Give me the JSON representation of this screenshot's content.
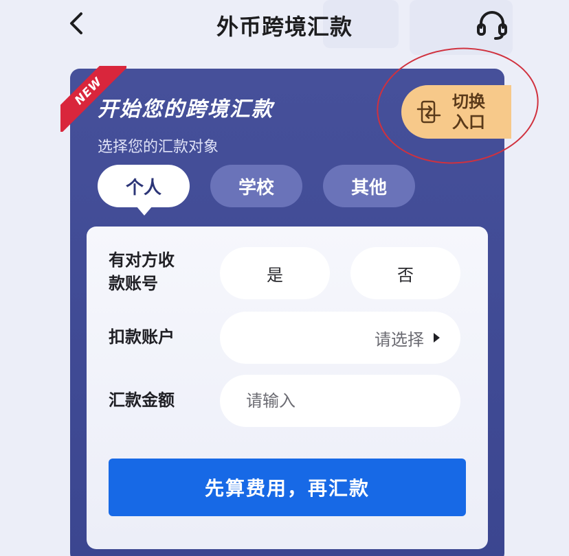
{
  "header": {
    "title": "外币跨境汇款",
    "back_icon": "chevron-left-icon",
    "service_icon": "headset-icon"
  },
  "card": {
    "ribbon": "NEW",
    "title": "开始您的跨境汇款",
    "subtitle": "选择您的汇款对象",
    "switch_label": "切换入口",
    "switch_icon": "switch-icon"
  },
  "tabs": [
    {
      "label": "个人",
      "active": true
    },
    {
      "label": "学校",
      "active": false
    },
    {
      "label": "其他",
      "active": false
    }
  ],
  "form": {
    "account_label": "有对方收款账号",
    "account_options": [
      "是",
      "否"
    ],
    "debit_label": "扣款账户",
    "debit_placeholder": "请选择",
    "amount_label": "汇款金额",
    "amount_placeholder": "请输入",
    "submit_label": "先算费用，再汇款"
  },
  "colors": {
    "card_bg": "#46509a",
    "switch_bg": "#f7c98a",
    "submit_bg": "#1769e6",
    "ribbon_bg": "#d9263c",
    "annotation_circle": "#d0313e"
  }
}
